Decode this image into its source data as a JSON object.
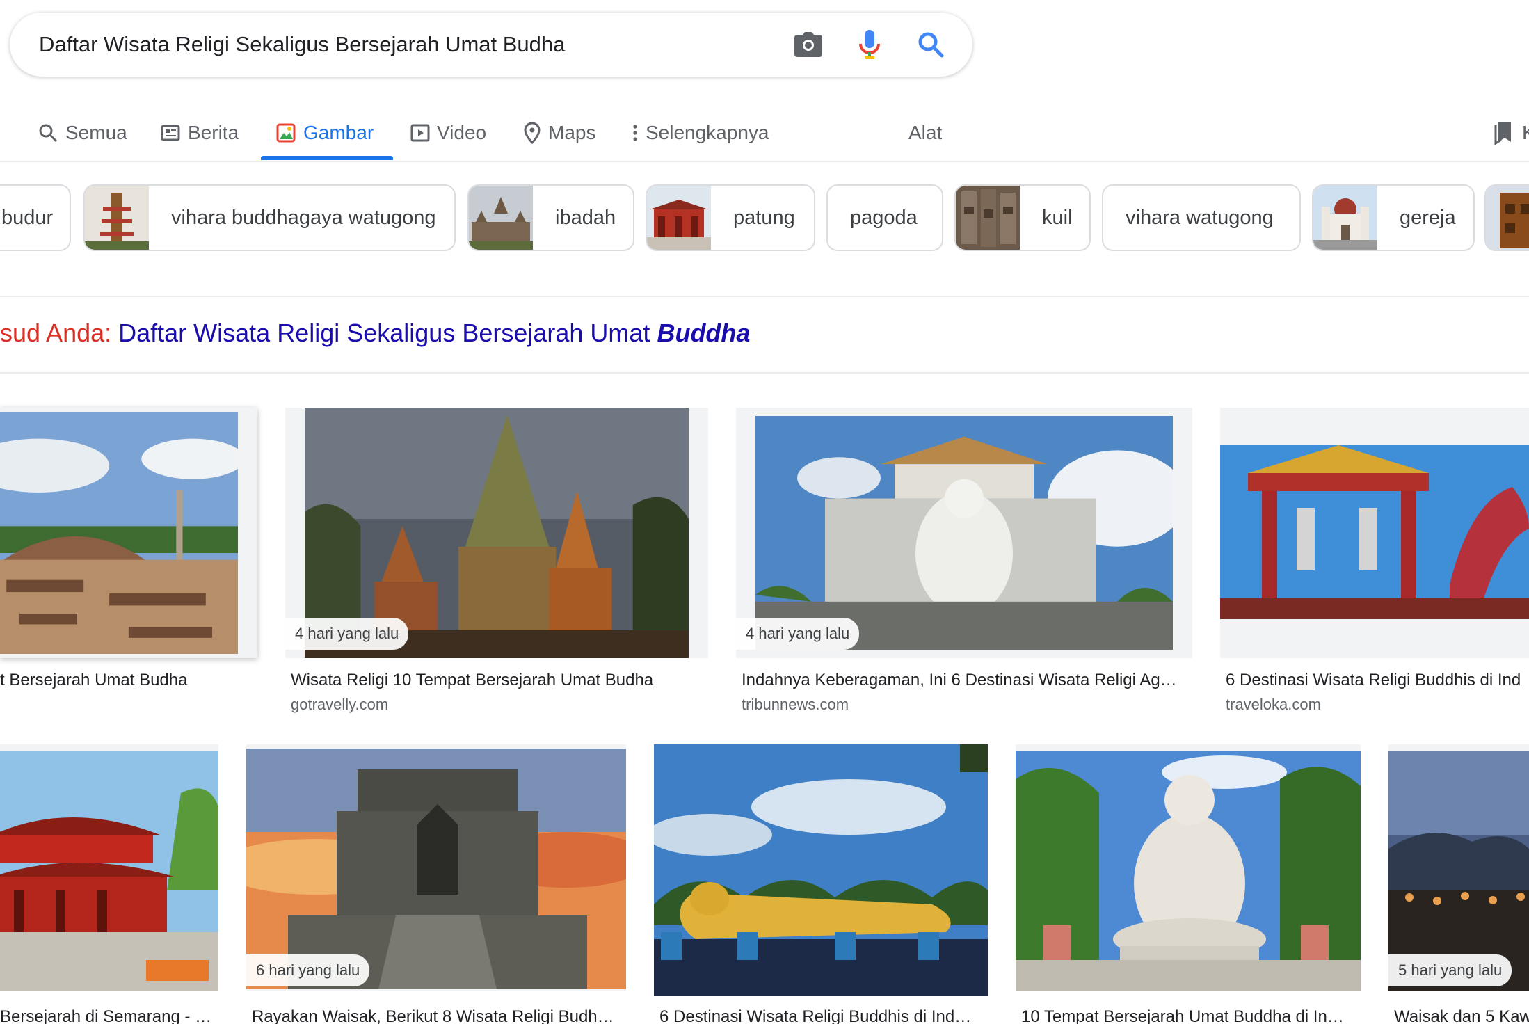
{
  "search": {
    "query": "Daftar Wisata Religi Sekaligus Bersejarah Umat Budha",
    "camera_icon": "camera-icon",
    "mic_icon": "mic-icon",
    "search_icon": "search-icon"
  },
  "tabs": [
    {
      "label": "Semua",
      "icon": "search-icon"
    },
    {
      "label": "Berita",
      "icon": "news-icon"
    },
    {
      "label": "Gambar",
      "icon": "image-icon",
      "active": true
    },
    {
      "label": "Video",
      "icon": "video-icon"
    },
    {
      "label": "Maps",
      "icon": "map-pin-icon"
    },
    {
      "label": "Selengkapnya",
      "icon": "more-vert-icon"
    }
  ],
  "tools_label": "Alat",
  "saved_label": "K",
  "chips": [
    {
      "label": "budur"
    },
    {
      "label": "vihara buddhagaya watugong"
    },
    {
      "label": "ibadah"
    },
    {
      "label": "patung"
    },
    {
      "label": "pagoda"
    },
    {
      "label": "kuil"
    },
    {
      "label": "vihara watugong"
    },
    {
      "label": "gereja"
    }
  ],
  "did_you_mean": {
    "prefix": "sud Anda: ",
    "link_text": "Daftar Wisata Religi Sekaligus Bersejarah Umat ",
    "link_emphasis": "Buddha"
  },
  "results_row1": [
    {
      "title": "t Bersejarah Umat Budha",
      "source": "",
      "badge": ""
    },
    {
      "title": "Wisata Religi 10 Tempat Bersejarah Umat Budha",
      "source": "gotravelly.com",
      "badge": "4 hari yang lalu"
    },
    {
      "title": "Indahnya Keberagaman, Ini 6 Destinasi Wisata Religi Ag…",
      "source": "tribunnews.com",
      "badge": "4 hari yang lalu"
    },
    {
      "title": "6 Destinasi Wisata Religi Buddhis di Ind",
      "source": "traveloka.com",
      "badge": ""
    }
  ],
  "results_row2": [
    {
      "title": "Bersejarah di Semarang - …",
      "badge": ""
    },
    {
      "title": "Rayakan Waisak, Berikut 8 Wisata Religi Budh…",
      "badge": "6 hari yang lalu"
    },
    {
      "title": "6 Destinasi Wisata Religi Buddhis di Ind…",
      "badge": ""
    },
    {
      "title": "10 Tempat Bersejarah Umat Buddha di In…",
      "badge": ""
    },
    {
      "title": "Waisak dan 5 Kaw",
      "badge": "5 hari yang lalu"
    }
  ],
  "colors": {
    "accent": "#1a73e8",
    "link": "#1a0dab",
    "dym_red": "#d93025"
  }
}
